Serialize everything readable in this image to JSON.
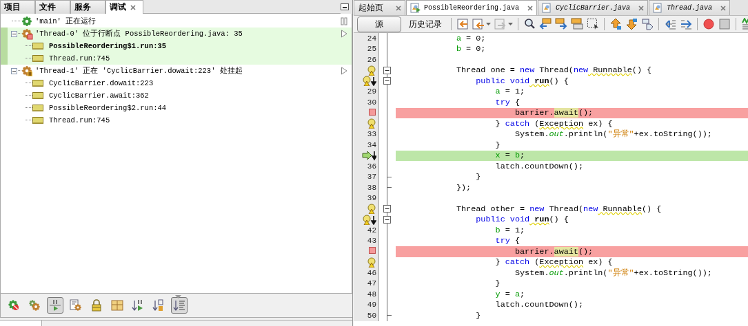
{
  "left_panel": {
    "tabs": [
      {
        "label": "项目",
        "selected": false,
        "closable": false
      },
      {
        "label": "文件",
        "selected": false,
        "closable": false
      },
      {
        "label": "服务",
        "selected": false,
        "closable": false
      },
      {
        "label": "调试",
        "selected": true,
        "closable": true
      }
    ],
    "threads": [
      {
        "label": "'main' 正在运行",
        "kind": "running",
        "selected": false
      },
      {
        "label": "'Thread-0' 位于行断点 PossibleReordering.java: 35",
        "kind": "breakpoint",
        "selected": true,
        "expanded": true,
        "frames": [
          {
            "label": "PossibleReordering$1.run:35",
            "current": true
          },
          {
            "label": "Thread.run:745",
            "current": false
          }
        ]
      },
      {
        "label": "'Thread-1' 正在 'CyclicBarrier.dowait:223' 处挂起",
        "kind": "suspended",
        "selected": false,
        "expanded": true,
        "frames": [
          {
            "label": "CyclicBarrier.dowait:223",
            "current": false
          },
          {
            "label": "CyclicBarrier.await:362",
            "current": false
          },
          {
            "label": "PossibleReordering$2.run:44",
            "current": false
          },
          {
            "label": "Thread.run:745",
            "current": false
          }
        ]
      }
    ],
    "toolbar": [
      {
        "on": false
      },
      {
        "on": false
      },
      {
        "on": true
      },
      {
        "on": false
      },
      {
        "on": false
      },
      {
        "on": false
      },
      {
        "on": false
      },
      {
        "on": false
      },
      {
        "on": true
      }
    ]
  },
  "editor": {
    "tabs": [
      {
        "label": "起始页",
        "selected": false,
        "italic": false,
        "file_icon": false
      },
      {
        "label": "PossibleReordering.java",
        "selected": true,
        "italic": false,
        "file_icon": true
      },
      {
        "label": "CyclicBarrier.java",
        "selected": false,
        "italic": true,
        "file_icon": true
      },
      {
        "label": "Thread.java",
        "selected": false,
        "italic": true,
        "file_icon": true
      }
    ],
    "modes": [
      {
        "label": "源",
        "selected": true
      },
      {
        "label": "历史记录",
        "selected": false
      }
    ],
    "lines": [
      {
        "kind": "number",
        "number": "24",
        "tokens": [
          {
            "text": "            a",
            "kind": "var"
          },
          {
            "text": " = 0;"
          }
        ]
      },
      {
        "kind": "number",
        "number": "25",
        "tokens": [
          {
            "text": "            b",
            "kind": "var"
          },
          {
            "text": " = 0;"
          }
        ]
      },
      {
        "kind": "number",
        "number": "26"
      },
      {
        "kind": "bulb",
        "fold_start": true,
        "tokens": [
          {
            "text": "            Thread one = "
          },
          {
            "text": "new",
            "kind": "kw"
          },
          {
            "text": " Thread("
          },
          {
            "text": "new",
            "kind": "kw"
          },
          {
            "text": " Runnable",
            "kind": "warn"
          },
          {
            "text": "() {"
          }
        ]
      },
      {
        "kind": "override",
        "fold_start": true,
        "tokens": [
          {
            "text": "                public void",
            "kind": "kw"
          },
          {
            "text": " run",
            "kind": "decl"
          },
          {
            "text": "() {"
          }
        ]
      },
      {
        "kind": "number",
        "number": "29",
        "tokens": [
          {
            "text": "                    a",
            "kind": "var"
          },
          {
            "text": " = 1;"
          }
        ]
      },
      {
        "kind": "number",
        "number": "30",
        "tokens": [
          {
            "text": "                    try",
            "kind": "kw"
          },
          {
            "text": " {"
          }
        ]
      },
      {
        "kind": "breakpoint",
        "tokens": [
          {
            "text": "                        barrier."
          },
          {
            "text": "await",
            "kind": "hl"
          },
          {
            "text": "();"
          }
        ]
      },
      {
        "kind": "bulb",
        "tokens": [
          {
            "text": "                    } "
          },
          {
            "text": "catch",
            "kind": "kw"
          },
          {
            "text": " ("
          },
          {
            "text": "Exception",
            "kind": "warn"
          },
          {
            "text": " ex) {"
          }
        ]
      },
      {
        "kind": "number",
        "number": "33",
        "tokens": [
          {
            "text": "                        System."
          },
          {
            "text": "out",
            "kind": "static"
          },
          {
            "text": ".println("
          },
          {
            "text": "\"异常\"",
            "kind": "str"
          },
          {
            "text": "+ex.toString());"
          }
        ]
      },
      {
        "kind": "number",
        "number": "34",
        "tokens": [
          {
            "text": "                    }"
          }
        ]
      },
      {
        "kind": "current",
        "tokens": [
          {
            "text": "                    x",
            "kind": "var"
          },
          {
            "text": " = "
          },
          {
            "text": "b",
            "kind": "var"
          },
          {
            "text": ";"
          }
        ]
      },
      {
        "kind": "number",
        "number": "36",
        "tokens": [
          {
            "text": "                    latch.countDown();"
          }
        ]
      },
      {
        "kind": "number",
        "number": "37",
        "fold_end": true,
        "tokens": [
          {
            "text": "                }"
          }
        ]
      },
      {
        "kind": "number",
        "number": "38",
        "fold_end": true,
        "tokens": [
          {
            "text": "            });"
          }
        ]
      },
      {
        "kind": "number",
        "number": "39"
      },
      {
        "kind": "bulb",
        "fold_start": true,
        "tokens": [
          {
            "text": "            Thread other = "
          },
          {
            "text": "new",
            "kind": "kw"
          },
          {
            "text": " Thread("
          },
          {
            "text": "new",
            "kind": "kw"
          },
          {
            "text": " Runnable",
            "kind": "warn"
          },
          {
            "text": "() {"
          }
        ]
      },
      {
        "kind": "override",
        "fold_start": true,
        "tokens": [
          {
            "text": "                public void",
            "kind": "kw"
          },
          {
            "text": " run",
            "kind": "decl"
          },
          {
            "text": "() {"
          }
        ]
      },
      {
        "kind": "number",
        "number": "42",
        "tokens": [
          {
            "text": "                    b",
            "kind": "var"
          },
          {
            "text": " = 1;"
          }
        ]
      },
      {
        "kind": "number",
        "number": "43",
        "tokens": [
          {
            "text": "                    try",
            "kind": "kw"
          },
          {
            "text": " {"
          }
        ]
      },
      {
        "kind": "breakpoint",
        "tokens": [
          {
            "text": "                        barrier."
          },
          {
            "text": "await",
            "kind": "hl"
          },
          {
            "text": "();"
          }
        ]
      },
      {
        "kind": "bulb",
        "tokens": [
          {
            "text": "                    } "
          },
          {
            "text": "catch",
            "kind": "kw"
          },
          {
            "text": " ("
          },
          {
            "text": "Exception",
            "kind": "warn"
          },
          {
            "text": " ex) {"
          }
        ]
      },
      {
        "kind": "number",
        "number": "46",
        "tokens": [
          {
            "text": "                        System."
          },
          {
            "text": "out",
            "kind": "static"
          },
          {
            "text": ".println("
          },
          {
            "text": "\"异常\"",
            "kind": "str"
          },
          {
            "text": "+ex.toString());"
          }
        ]
      },
      {
        "kind": "number",
        "number": "47",
        "tokens": [
          {
            "text": "                    }"
          }
        ]
      },
      {
        "kind": "number",
        "number": "48",
        "tokens": [
          {
            "text": "                    y",
            "kind": "var"
          },
          {
            "text": " = "
          },
          {
            "text": "a",
            "kind": "var"
          },
          {
            "text": ";"
          }
        ]
      },
      {
        "kind": "number",
        "number": "49",
        "tokens": [
          {
            "text": "                    latch.countDown();"
          }
        ]
      },
      {
        "kind": "number",
        "number": "50",
        "fold_end": true,
        "tokens": [
          {
            "text": "                }"
          }
        ]
      }
    ]
  }
}
